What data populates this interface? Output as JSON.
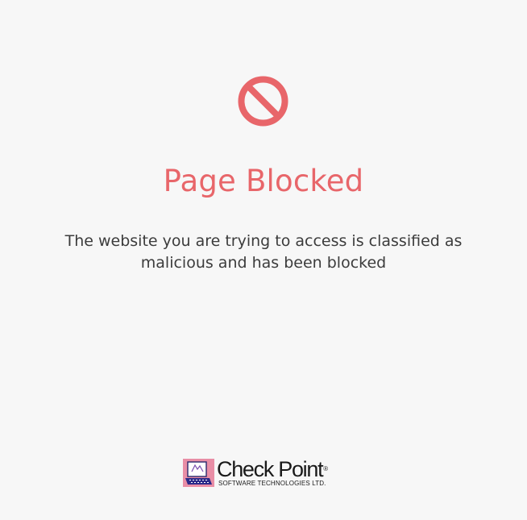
{
  "page": {
    "title": "Page Blocked",
    "message": "The website you are trying to access is classified as malicious and has been blocked",
    "icon": "blocked-icon",
    "accent_color": "#e8666a"
  },
  "footer": {
    "logo": {
      "icon": "check-point-logo-icon",
      "name": "Check Point",
      "registered": "®",
      "tagline": "SOFTWARE TECHNOLOGIES LTD."
    }
  }
}
